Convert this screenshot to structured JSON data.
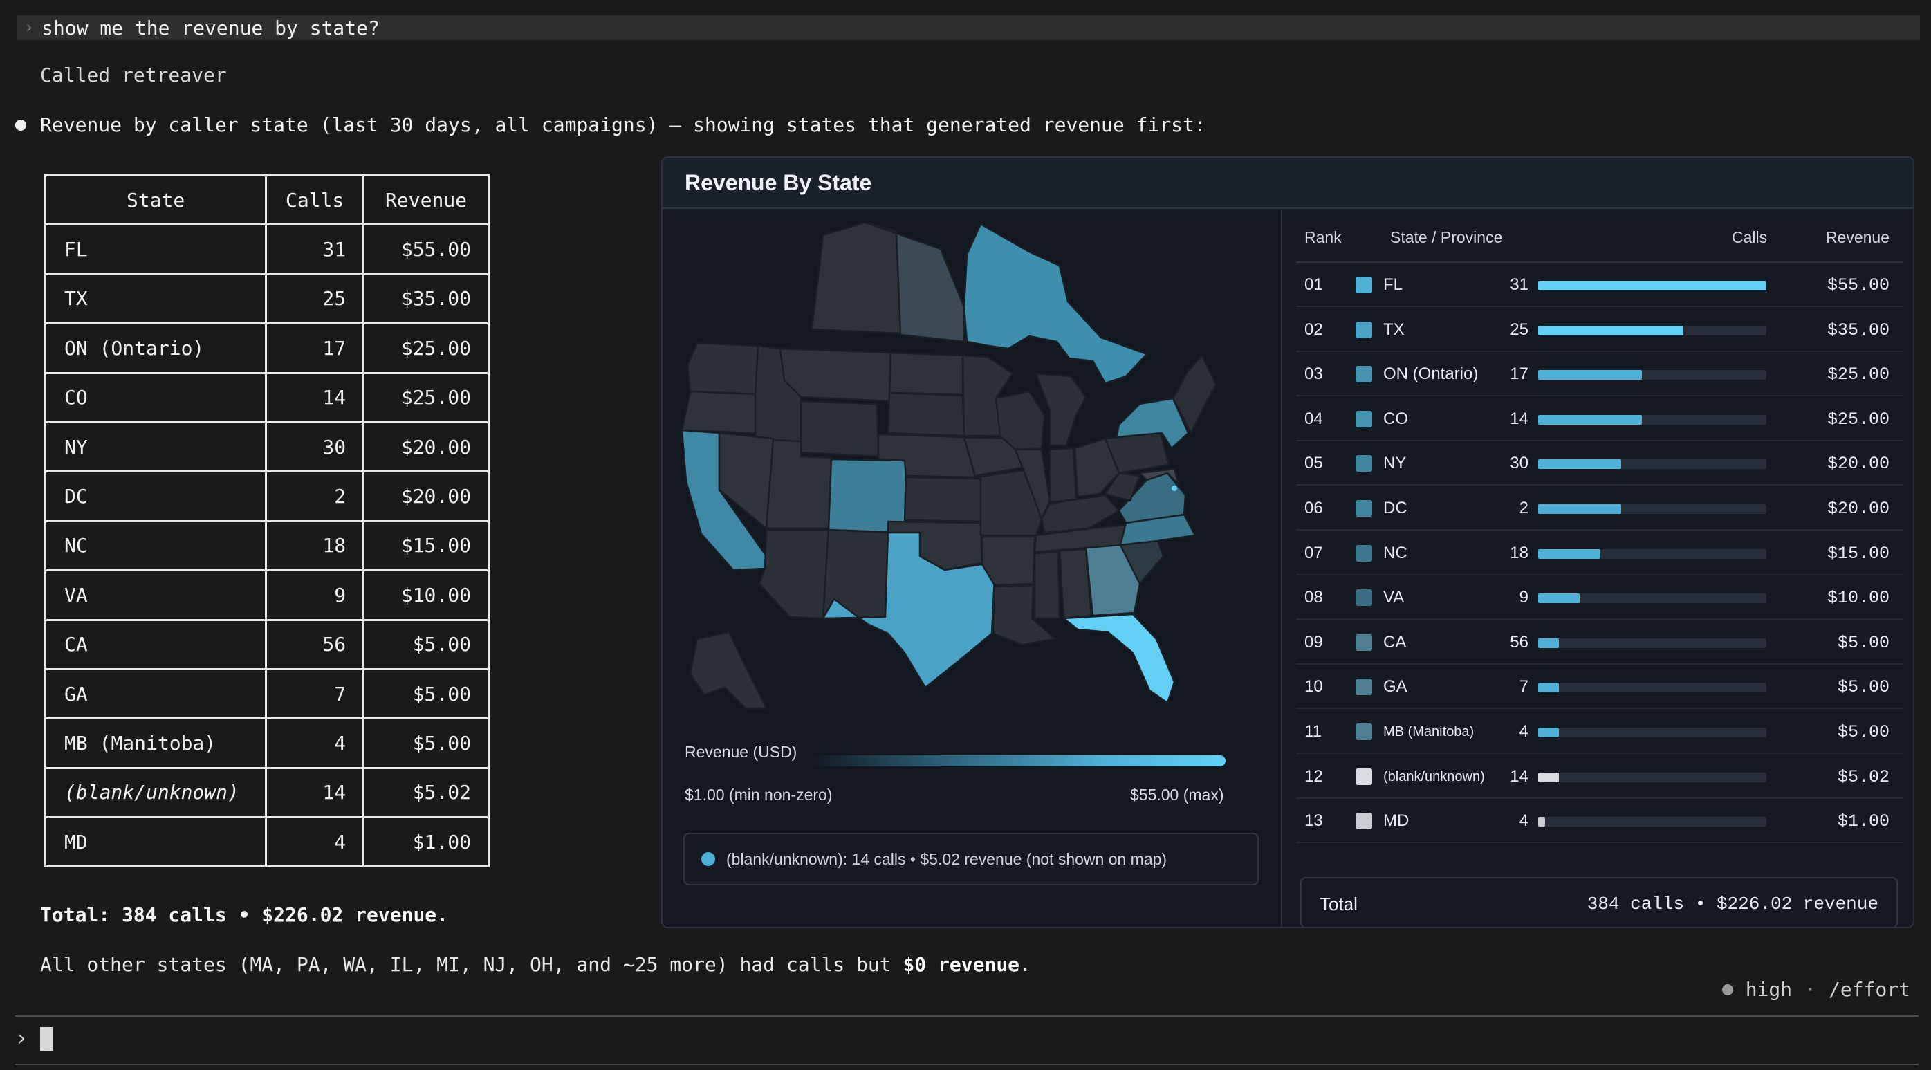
{
  "prompt": {
    "query": "show me the revenue by state?"
  },
  "called_text": "Called retreaver",
  "summary_text": "Revenue by caller state (last 30 days, all campaigns) — showing states that generated revenue first:",
  "table": {
    "headers": [
      "State",
      "Calls",
      "Revenue"
    ],
    "rows": [
      {
        "state": "FL",
        "calls": "31",
        "revenue": "$55.00"
      },
      {
        "state": "TX",
        "calls": "25",
        "revenue": "$35.00"
      },
      {
        "state": "ON (Ontario)",
        "calls": "17",
        "revenue": "$25.00"
      },
      {
        "state": "CO",
        "calls": "14",
        "revenue": "$25.00"
      },
      {
        "state": "NY",
        "calls": "30",
        "revenue": "$20.00"
      },
      {
        "state": "DC",
        "calls": "2",
        "revenue": "$20.00"
      },
      {
        "state": "NC",
        "calls": "18",
        "revenue": "$15.00"
      },
      {
        "state": "VA",
        "calls": "9",
        "revenue": "$10.00"
      },
      {
        "state": "CA",
        "calls": "56",
        "revenue": "$5.00"
      },
      {
        "state": "GA",
        "calls": "7",
        "revenue": "$5.00"
      },
      {
        "state": "MB (Manitoba)",
        "calls": "4",
        "revenue": "$5.00"
      },
      {
        "state": "(blank/unknown)",
        "calls": "14",
        "revenue": "$5.02"
      },
      {
        "state": "MD",
        "calls": "4",
        "revenue": "$1.00"
      }
    ]
  },
  "total_text": "Total: 384 calls • $226.02 revenue.",
  "others_prefix": "All other states (MA, PA, WA, IL, MI, NJ, OH, and ~25 more) had calls but ",
  "others_bold": "$0 revenue",
  "others_suffix": ".",
  "effort": {
    "level": "high",
    "command": "/effort"
  },
  "panel": {
    "title": "Revenue By State",
    "legend_label": "Revenue (USD)",
    "legend_min": "$1.00 (min non-zero)",
    "legend_max": "$55.00 (max)",
    "note": "(blank/unknown): 14 calls • $5.02 revenue (not shown on map)",
    "colors": {
      "accent": "#62d0f5",
      "map_base": "#2e333a",
      "panel_bg": "#151a22"
    },
    "rank_headers": {
      "rank": "Rank",
      "state": "State / Province",
      "calls": "Calls",
      "revenue": "Revenue"
    },
    "ranks": [
      {
        "rank": "01",
        "state": "FL",
        "calls": "31",
        "revenue": "$55.00",
        "value": 55,
        "color": "#4fb0d8"
      },
      {
        "rank": "02",
        "state": "TX",
        "calls": "25",
        "revenue": "$35.00",
        "value": 35,
        "color": "#4aa3c6"
      },
      {
        "rank": "03",
        "state": "ON (Ontario)",
        "calls": "17",
        "revenue": "$25.00",
        "value": 25,
        "color": "#4693b0"
      },
      {
        "rank": "04",
        "state": "CO",
        "calls": "14",
        "revenue": "$25.00",
        "value": 25,
        "color": "#4693b0"
      },
      {
        "rank": "05",
        "state": "NY",
        "calls": "30",
        "revenue": "$20.00",
        "value": 20,
        "color": "#3f86a0"
      },
      {
        "rank": "06",
        "state": "DC",
        "calls": "2",
        "revenue": "$20.00",
        "value": 20,
        "color": "#3f86a0"
      },
      {
        "rank": "07",
        "state": "NC",
        "calls": "18",
        "revenue": "$15.00",
        "value": 15,
        "color": "#3b7990"
      },
      {
        "rank": "08",
        "state": "VA",
        "calls": "9",
        "revenue": "$10.00",
        "value": 10,
        "color": "#386d82"
      },
      {
        "rank": "09",
        "state": "CA",
        "calls": "56",
        "revenue": "$5.00",
        "value": 5,
        "color": "#4d7e92"
      },
      {
        "rank": "10",
        "state": "GA",
        "calls": "7",
        "revenue": "$5.00",
        "value": 5,
        "color": "#4d7e92"
      },
      {
        "rank": "11",
        "state": "MB (Manitoba)",
        "calls": "4",
        "revenue": "$5.00",
        "value": 5,
        "color": "#4d7e92"
      },
      {
        "rank": "12",
        "state": "(blank/unknown)",
        "calls": "14",
        "revenue": "$5.02",
        "value": 5.02,
        "color": "#d9dde2"
      },
      {
        "rank": "13",
        "state": "MD",
        "calls": "4",
        "revenue": "$1.00",
        "value": 1,
        "color": "#c9cdd2"
      }
    ],
    "total_label": "Total",
    "total_value": "384 calls • $226.02 revenue"
  }
}
